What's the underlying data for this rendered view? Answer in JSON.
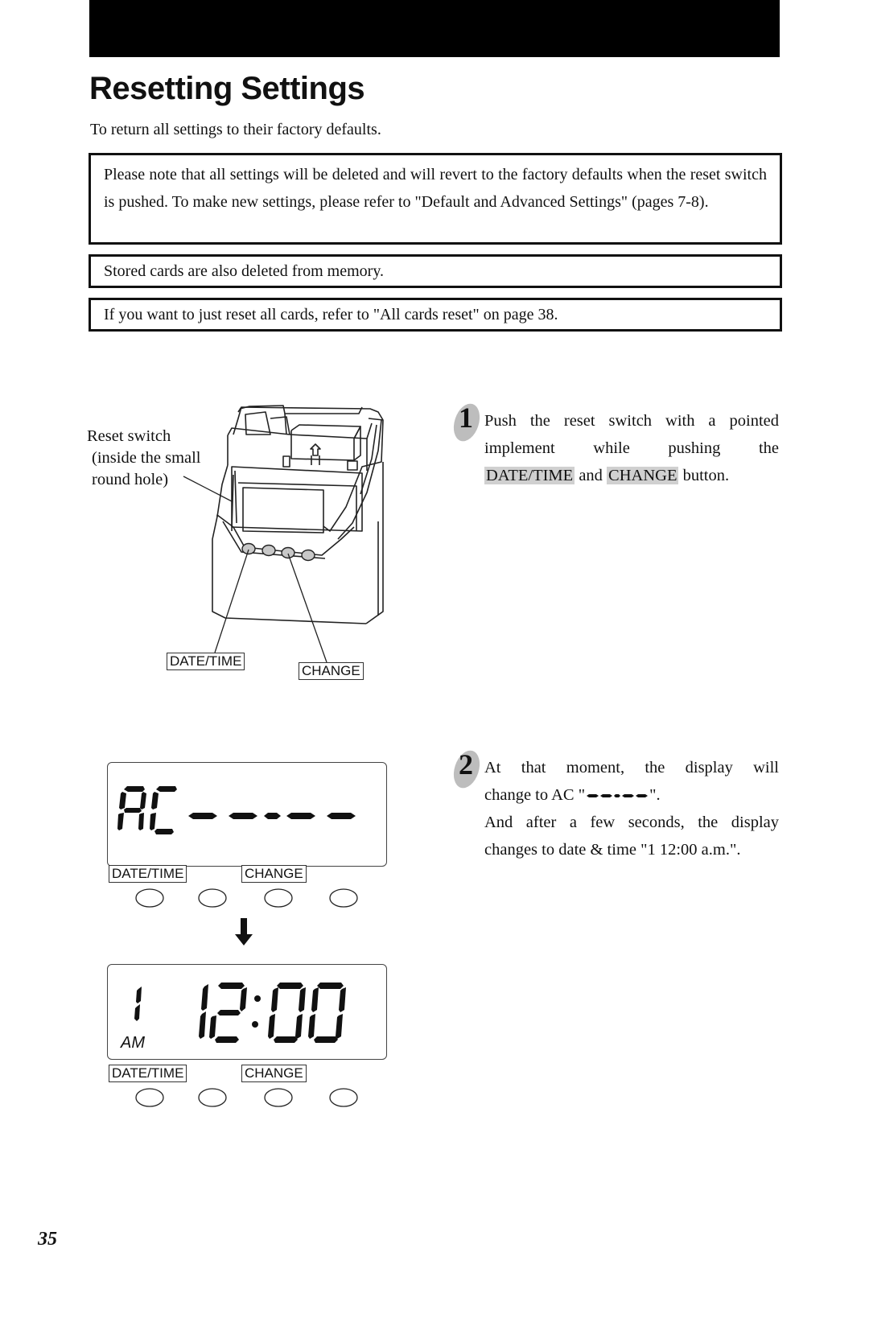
{
  "header": {
    "title": "Resetting Settings",
    "intro": "To return all settings to their factory defaults."
  },
  "notes": [
    "Please note that all settings will be deleted and will revert to the factory defaults when the reset switch is pushed.  To make new settings, please refer to \"Default and Advanced Settings\" (pages 7-8).",
    "Stored cards are also deleted from memory.",
    "If you want to just reset all cards, refer to \"All cards reset\" on page 38."
  ],
  "illustration": {
    "reset_label": [
      "Reset switch",
      "(inside the small",
      "round hole)"
    ],
    "button_labels": {
      "date_time": "DATE/TIME",
      "change": "CHANGE"
    }
  },
  "steps": [
    {
      "number": "1",
      "lines": [
        "Push the reset switch with a pointed",
        "implement while pushing the"
      ],
      "last_line": {
        "key1": "DATE/TIME",
        "mid": " and ",
        "key2": "CHANGE",
        "end": " button."
      }
    },
    {
      "number": "2",
      "line1": "At that moment, the display will",
      "line2_prefix": "change to AC \"",
      "line2_suffix": "\".",
      "line3": "And after a few seconds, the display",
      "line4": "changes to date & time \"1  12:00 a.m.\"."
    }
  ],
  "displays": [
    {
      "text": "AC -----",
      "buttons": {
        "date_time": "DATE/TIME",
        "change": "CHANGE"
      }
    },
    {
      "day": "1",
      "time": "12:00",
      "meridiem": "AM",
      "buttons": {
        "date_time": "DATE/TIME",
        "change": "CHANGE"
      }
    }
  ],
  "page_number": "35"
}
